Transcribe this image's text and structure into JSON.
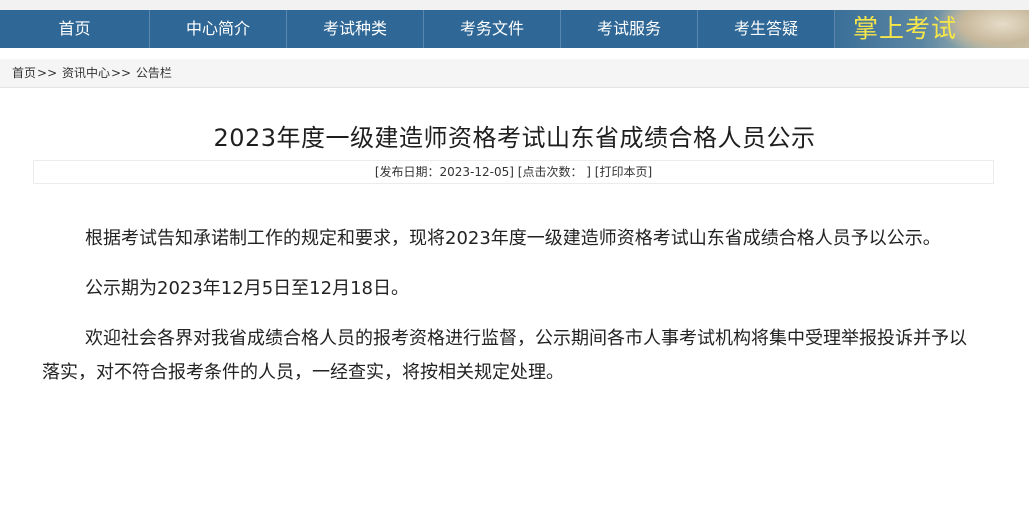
{
  "nav": {
    "items": [
      "首页",
      "中心简介",
      "考试种类",
      "考务文件",
      "考试服务",
      "考生答疑"
    ],
    "brand": "掌上考试"
  },
  "breadcrumb": {
    "home": "首页",
    "sep1": ">>",
    "section": "资讯中心",
    "sep2": ">>",
    "current": "公告栏"
  },
  "article": {
    "title": "2023年度一级建造师资格考试山东省成绩合格人员公示",
    "publish_date": "[发布日期：2023-12-05]",
    "click_count": "[点击次数：  ]",
    "print": "[打印本页]",
    "paragraphs": [
      "根据考试告知承诺制工作的规定和要求，现将2023年度一级建造师资格考试山东省成绩合格人员予以公示。",
      "公示期为2023年12月5日至12月18日。",
      "欢迎社会各界对我省成绩合格人员的报考资格进行监督，公示期间各市人事考试机构将集中受理举报投诉并予以落实，对不符合报考条件的人员，一经查实，将按相关规定处理。"
    ]
  },
  "colors": {
    "nav_bg": "#2f6796",
    "brand_text": "#f7e64a"
  }
}
